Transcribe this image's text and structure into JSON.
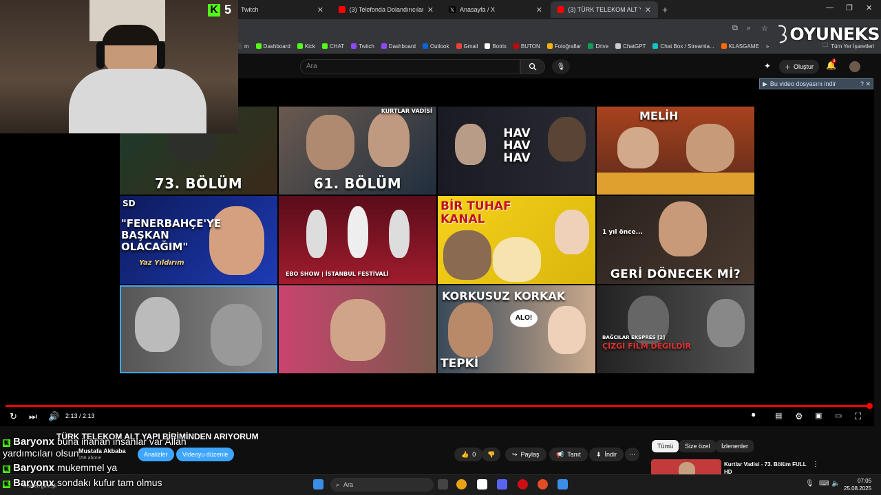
{
  "browser": {
    "tabs": [
      {
        "label": "Twitch",
        "active": false
      },
      {
        "label": "(3) Telefonda Dolandırıcılara Eş",
        "active": false
      },
      {
        "label": "Anasayfa / X",
        "active": false
      },
      {
        "label": "(3) TÜRK TELEKOM ALT YAPI Bİ",
        "active": true
      }
    ],
    "new_tab": "+",
    "bookmarks": [
      {
        "label": "m",
        "color": "#444"
      },
      {
        "label": "Dashboard",
        "color": "#53fc18"
      },
      {
        "label": "Kick",
        "color": "#53fc18"
      },
      {
        "label": "CHAT",
        "color": "#53fc18"
      },
      {
        "label": "Twitch",
        "color": "#9146ff"
      },
      {
        "label": "Dashboard",
        "color": "#9146ff"
      },
      {
        "label": "Outlook",
        "color": "#0a64d8"
      },
      {
        "label": "Gmail",
        "color": "#ea4335"
      },
      {
        "label": "Botrix",
        "color": "#ffffff"
      },
      {
        "label": "BUTON",
        "color": "#cc0000"
      },
      {
        "label": "Fotoğraflar",
        "color": "#f4b400"
      },
      {
        "label": "Drive",
        "color": "#0f9d58"
      },
      {
        "label": "ChatGPT",
        "color": "#cccccc"
      },
      {
        "label": "Chat Box / Streamla...",
        "color": "#16c2c2"
      },
      {
        "label": "KLASGAME",
        "color": "#ff6a00"
      }
    ],
    "bookmarks_more": "»",
    "all_bookmarks": "Tüm Yer İşaretleri"
  },
  "youtube": {
    "search_placeholder": "Ara",
    "create_label": "Oluştur",
    "notification_count": "3",
    "download_bar": "Bu video dosyasını indir",
    "player": {
      "time": "2:13 / 2:13",
      "progress": 1.0
    },
    "endscreen": [
      {
        "caption": "73. BÖLÜM",
        "colors": [
          "#1d3b2a",
          "#3a2a1a"
        ]
      },
      {
        "caption": "61. BÖLÜM",
        "colors": [
          "#4a3a30",
          "#1f2e3d"
        ],
        "tag": "KURTLAR VADİSİ"
      },
      {
        "caption": "HAV HAV HAV",
        "colors": [
          "#1a1a22",
          "#2a2a33"
        ]
      },
      {
        "caption": "MELİH",
        "colors": [
          "#a8421f",
          "#5a2a1a"
        ]
      },
      {
        "caption": "\"FENERBAHÇE'YE BAŞKAN OLACAĞIM\"",
        "sub": "Yaz Yıldırım",
        "tag": "SD",
        "colors": [
          "#0d1a5a",
          "#1e3bb5"
        ]
      },
      {
        "caption": "EBO SHOW | İSTANBUL FESTİVALİ",
        "colors": [
          "#5a0c1a",
          "#a01c2c"
        ]
      },
      {
        "caption": "BİR TUHAF KANAL",
        "colors": [
          "#f5d21a",
          "#d9b60c"
        ]
      },
      {
        "caption": "GERİ DÖNECEK Mİ?",
        "tag": "1 yıl önce...",
        "colors": [
          "#2a221e",
          "#4a3a30"
        ]
      },
      {
        "caption": "",
        "colors": [
          "#444",
          "#777"
        ]
      },
      {
        "caption": "",
        "colors": [
          "#c9436f",
          "#7a5a4c"
        ]
      },
      {
        "caption": "KORKUSUZ KORKAK",
        "sub": "TEPKİ",
        "bubble": "ALO!",
        "colors": [
          "#3a4a5a",
          "#c9a98c"
        ]
      },
      {
        "caption": "ÇİZGİ FİLM DEĞİLDİR",
        "tag": "BAĞCILAR EKSPRES [2]",
        "colors": [
          "#222",
          "#555"
        ]
      }
    ],
    "video": {
      "title": "TÜRK TELEKOM ALT YAPI BİRİMİNDEN ARIYORUM",
      "channel": "Mustafa Akbaba",
      "subscribers": "156 abone",
      "analytics_label": "Analizler",
      "edit_label": "Videoyu düzenle",
      "likes": "0",
      "share_label": "Paylaş",
      "promote_label": "Tanıt",
      "download_label": "İndir",
      "more": "⋯"
    },
    "chips": [
      {
        "label": "Tümü",
        "selected": true
      },
      {
        "label": "Size özel",
        "selected": false
      },
      {
        "label": "İzlenenler",
        "selected": false
      }
    ],
    "recommended": {
      "title": "Kurtlar Vadisi - 73. Bölüm FULL HD"
    }
  },
  "overlay": {
    "kick_count": "5",
    "brand": "OYUNEKS",
    "chat": [
      {
        "user": "Baryonx",
        "message": "buna inanan insanlar var Allah"
      },
      {
        "user": "",
        "message": "yardımcıları olsun"
      },
      {
        "user": "Baryonx",
        "message": "mukemmel ya"
      },
      {
        "user": "Baryonx",
        "message": "sondakı kufur tam olmus"
      }
    ]
  },
  "taskbar": {
    "search_label": "Ara",
    "weather": "Kısmen güneşli",
    "time": "07:05",
    "date": "25.08.2025"
  }
}
